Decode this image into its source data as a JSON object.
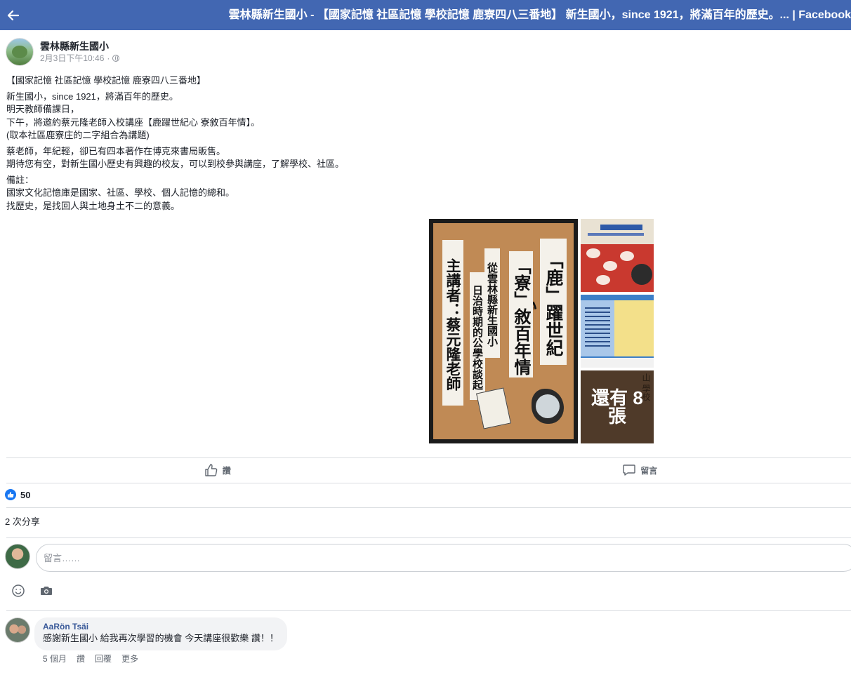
{
  "topbar": {
    "title": "雲林縣新生國小 - 【國家記憶 社區記憶 學校記憶 鹿寮四八三番地】 新生國小，since 1921，將滿百年的歷史。... | Facebook",
    "back_icon": "back-arrow-icon"
  },
  "post": {
    "page_name": "雲林縣新生國小",
    "time": "2月3日下午10:46",
    "privacy_icon": "globe-icon",
    "paragraphs": [
      "【國家記憶 社區記憶 學校記憶 鹿寮四八三番地】",
      "新生國小，since 1921，將滿百年的歷史。\n明天教師備課日，\n下午，將邀約蔡元隆老師入校講座【鹿躍世紀心 寮敘百年情】。\n(取本社區鹿寮庄的二字組合為講題)",
      "蔡老師，年紀輕，卻已有四本著作在博克來書局販售。\n期待您有空，對新生國小歷史有興趣的校友，可以到校參與講座，了解學校、社區。",
      "備註：\n國家文化記憶庫是國家、社區、學校、個人記憶的總和。\n找歷史，是找回人與土地身土不二的意義。"
    ],
    "photos": {
      "poster_col1": "「鹿」躍世紀心",
      "poster_col2": "「寮」敘百年情",
      "poster_col3": "從雲林縣新生國小",
      "poster_col4": "日治時期的公學校談起",
      "poster_col5": "主講者：蔡元隆老師",
      "thumb1_title": "日治時期",
      "thumb3_bg": "山 學校",
      "more_label": "還有 8 張"
    }
  },
  "actions": {
    "like_label": "讚",
    "comment_label": "留言"
  },
  "reactions": {
    "count": "50"
  },
  "shares": {
    "label": "2 次分享"
  },
  "composer": {
    "placeholder": "留言……",
    "value": ""
  },
  "comment": {
    "author": "AaRön Tsäi",
    "text": "感謝新生國小 給我再次學習的機會 今天講座很歡樂 讚！！",
    "time": "5 個月",
    "like": "讚",
    "reply": "回覆",
    "more": "更多"
  },
  "colors": {
    "brand": "#4267b2",
    "like": "#1877f2",
    "link": "#385898"
  }
}
